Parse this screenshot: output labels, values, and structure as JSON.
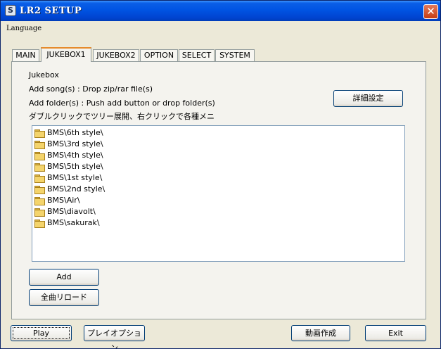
{
  "window": {
    "title": "LR2 SETUP",
    "close_glyph": "✕"
  },
  "menubar": {
    "language": "Language"
  },
  "tabs": [
    {
      "label": "MAIN",
      "active": false
    },
    {
      "label": "JUKEBOX1",
      "active": true
    },
    {
      "label": "JUKEBOX2",
      "active": false
    },
    {
      "label": "OPTION",
      "active": false
    },
    {
      "label": "SELECT",
      "active": false
    },
    {
      "label": "SYSTEM",
      "active": false
    }
  ],
  "jukebox": {
    "heading": "Jukebox",
    "add_songs_hint": "Add song(s) : Drop zip/rar file(s)",
    "add_folder_hint": "Add folder(s) : Push add button or drop folder(s)",
    "tree_hint": "ダブルクリックでツリー展開、右クリックで各種メニ",
    "detail_settings_button": "詳細設定",
    "folders": [
      "BMS\\6th style\\",
      "BMS\\3rd style\\",
      "BMS\\4th style\\",
      "BMS\\5th style\\",
      "BMS\\1st style\\",
      "BMS\\2nd style\\",
      "BMS\\Air\\",
      "BMS\\diavolt\\",
      "BMS\\sakurak\\"
    ],
    "add_button": "Add",
    "reload_all_button": "全曲リロード"
  },
  "footer": {
    "play_button": "Play",
    "play_option_button": "プレイオプション",
    "make_movie_button": "動画作成",
    "exit_button": "Exit"
  }
}
